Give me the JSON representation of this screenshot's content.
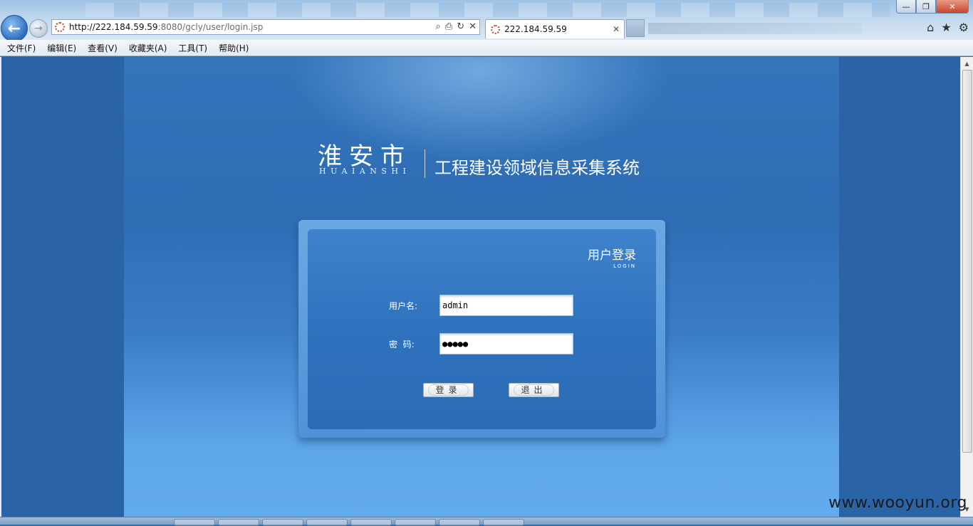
{
  "browser": {
    "address_url_host": "http://222.184.59.59",
    "address_url_path": ":8080/gcly/user/login.jsp",
    "tab_title": "222.184.59.59",
    "window_buttons": [
      "—",
      "❐",
      "✕"
    ]
  },
  "menubar": {
    "items": [
      "文件(F)",
      "编辑(E)",
      "查看(V)",
      "收藏夹(A)",
      "工具(T)",
      "帮助(H)"
    ]
  },
  "page": {
    "city_name": "淮安市",
    "city_pinyin": "HUAIANSHI",
    "system_title": "工程建设领域信息采集系统",
    "login": {
      "title_cn": "用户登录",
      "title_en": "LOGIN",
      "username_label": "用户名:",
      "username_value": "admin",
      "password_label": "密  码:",
      "password_value": "●●●●●",
      "login_button": "登录",
      "exit_button": "退出"
    }
  },
  "watermark": "www.wooyun.org",
  "colors": {
    "page_background": "#2f6fb0",
    "panel_outer": "#5b9adb",
    "panel_inner": "#3476c2"
  }
}
